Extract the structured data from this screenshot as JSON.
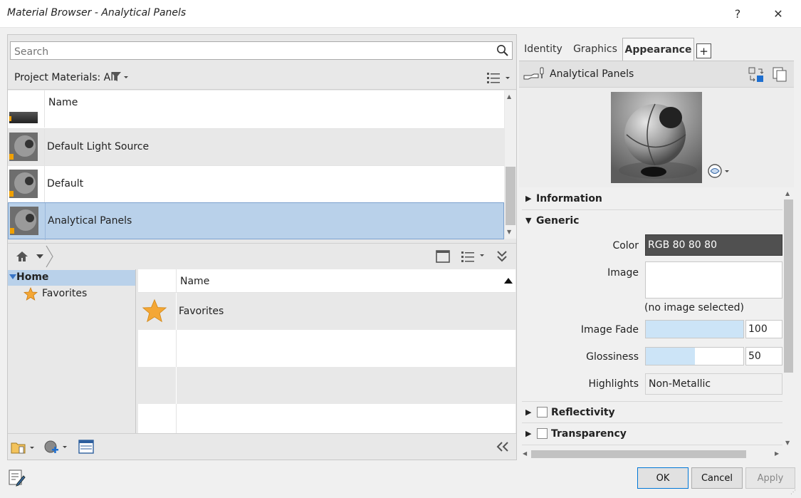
{
  "window": {
    "title": "Material Browser - Analytical Panels",
    "help_glyph": "?",
    "close_glyph": "✕"
  },
  "search": {
    "placeholder": "Search"
  },
  "project_filter": {
    "label": "Project Materials: All"
  },
  "material_list": {
    "header": "Name",
    "rows": [
      {
        "label": "Default Light Source",
        "selected": false
      },
      {
        "label": "Default",
        "selected": false
      },
      {
        "label": "Analytical Panels",
        "selected": true
      }
    ]
  },
  "library_tree": {
    "home_label": "Home",
    "favorites_label": "Favorites"
  },
  "library_list": {
    "header": "Name",
    "rows": [
      {
        "label": "Favorites"
      }
    ]
  },
  "tabs": [
    {
      "label": "Identity",
      "active": false
    },
    {
      "label": "Graphics",
      "active": false
    },
    {
      "label": "Appearance",
      "active": true
    }
  ],
  "add_tab_glyph": "+",
  "asset": {
    "name": "Analytical Panels"
  },
  "sections": {
    "information": "Information",
    "generic": "Generic",
    "reflectivity": "Reflectivity",
    "transparency": "Transparency"
  },
  "generic": {
    "color_label": "Color",
    "color_value": "RGB 80 80 80",
    "color_swatch": "#505050",
    "image_label": "Image",
    "image_status": "(no image selected)",
    "image_fade_label": "Image Fade",
    "image_fade_value": "100",
    "image_fade_fraction": 1.0,
    "glossiness_label": "Glossiness",
    "glossiness_value": "50",
    "glossiness_fraction": 0.5,
    "highlights_label": "Highlights",
    "highlights_value": "Non-Metallic"
  },
  "buttons": {
    "ok": "OK",
    "cancel": "Cancel",
    "apply": "Apply"
  },
  "colors": {
    "selection": "#b9d1ea",
    "slider_fill": "#cce4f7",
    "star": "#f4a735"
  }
}
